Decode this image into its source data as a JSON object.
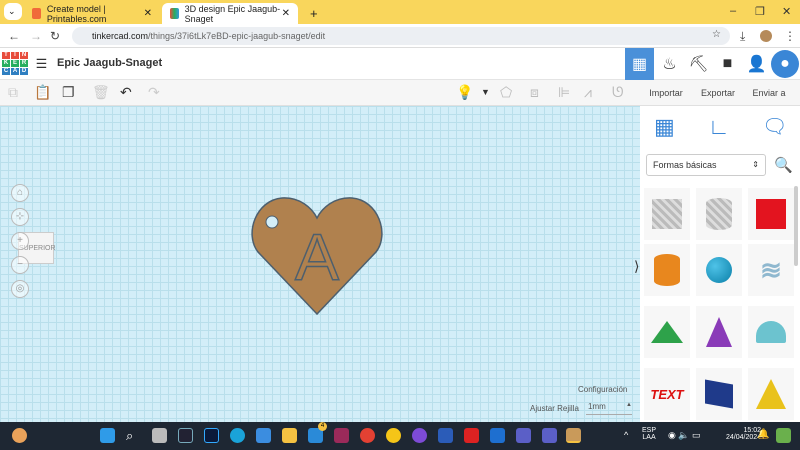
{
  "browser": {
    "tabs": [
      {
        "label": "Create model | Printables.com",
        "active": false
      },
      {
        "label": "3D design Epic Jaagub-Snaget",
        "active": true
      }
    ],
    "new_tab": "+",
    "url_host": "tinkercad.com",
    "url_path": "/things/37i6tLk7eBD-epic-jaagub-snaget/edit",
    "window_controls": [
      "–",
      "❐",
      "✕"
    ]
  },
  "app": {
    "logo_letters": [
      "T",
      "I",
      "N",
      "K",
      "E",
      "R",
      "C",
      "A",
      "D"
    ],
    "design_title": "Epic Jaagub-Snaget"
  },
  "toolbar": {
    "import": "Importar",
    "export": "Exportar",
    "send": "Enviar a"
  },
  "canvas": {
    "view_cube_label": "SUPERIOR",
    "model_letter": "A",
    "settings": "Configuración",
    "snap_label": "Ajustar Rejilla",
    "snap_value": "1mm"
  },
  "panel": {
    "category": "Formas básicas",
    "shapes": [
      "Box Hole",
      "Cylinder Hole",
      "Box",
      "Cylinder",
      "Sphere",
      "Scribble",
      "Roof",
      "Cone",
      "Round Roof",
      "Text",
      "Polygon",
      "Pyramid"
    ]
  },
  "colors": {
    "tabbar": "#f9d65c",
    "accent": "#4a90d9",
    "heart": "#b0814e",
    "grid": "#d3eef8"
  },
  "taskbar": {
    "notification_badge": "4",
    "lang": "ESP",
    "lang2": "LAA",
    "time": "15:02",
    "date": "24/04/2024"
  }
}
